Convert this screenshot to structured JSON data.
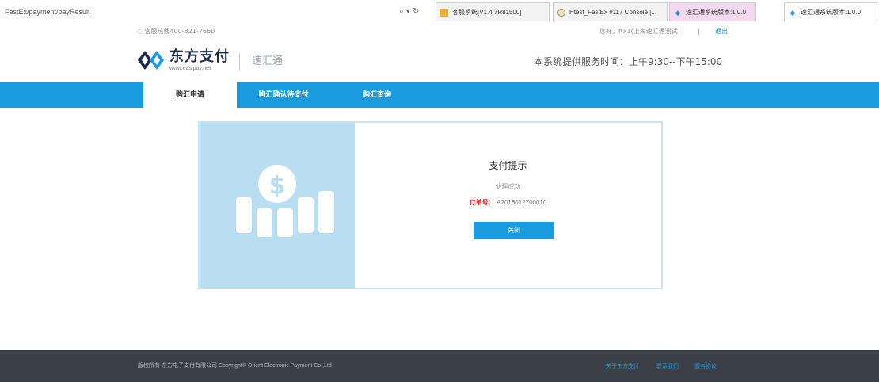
{
  "browser": {
    "address": "FastEx/payment/payResult",
    "address_controls": "⌕ ▾ ↻",
    "tabs": [
      {
        "label": "客服系统[V1.4.7R81500]",
        "icon": "folder-icon"
      },
      {
        "label": "Htest_FastEx #117 Console [...",
        "icon": "jenkins-icon"
      },
      {
        "label": "速汇通系统版本:1.0.0",
        "icon": "eye-icon"
      },
      {
        "label": "速汇通系统版本:1.0.0",
        "icon": "eye-icon"
      }
    ]
  },
  "utility": {
    "hotline": "◌ 客服热线400-821-7660",
    "greeting": "您好，ftx1(上海速汇通测试)",
    "separator": "|",
    "logout": "退出"
  },
  "header": {
    "logo_text": "东方支付",
    "logo_url": "www.easipay.net",
    "product": "速汇通",
    "service_time": "本系统提供服务时间：上午9:30--下午15:00"
  },
  "nav": {
    "items": [
      {
        "label": "购汇申请",
        "active": true
      },
      {
        "label": "购汇确认待支付",
        "active": false
      },
      {
        "label": "购汇查询",
        "active": false
      }
    ]
  },
  "card": {
    "title": "支付提示",
    "status": "处理成功",
    "order_label": "订单号：",
    "order_no": "A2018012700010",
    "close_label": "关闭"
  },
  "footer": {
    "copyright": "版权所有 东方电子支付有限公司 Copyright© Orient Electronic Payment Co.,Ltd",
    "links": [
      "关于东方支付",
      "联系我们",
      "服务协议"
    ]
  },
  "colors": {
    "brand_blue": "#1a9be0",
    "card_left_bg": "#b9def2",
    "order_red": "#e02020",
    "footer_bg": "#3a3f48"
  }
}
